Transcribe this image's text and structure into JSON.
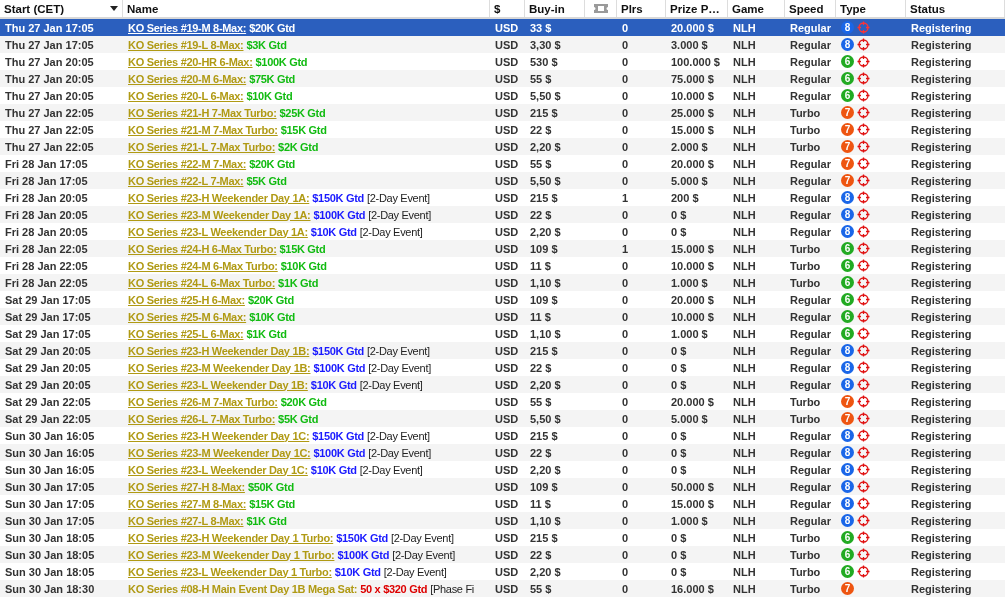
{
  "table": {
    "columns": [
      {
        "kind": "text",
        "label": "Start (CET)",
        "sort_descending": true
      },
      {
        "kind": "text",
        "label": "Name"
      },
      {
        "kind": "text",
        "label": "$"
      },
      {
        "kind": "text",
        "label": "Buy-in"
      },
      {
        "kind": "icon"
      },
      {
        "kind": "text",
        "label": "Plrs"
      },
      {
        "kind": "text",
        "label": "Prize P…"
      },
      {
        "kind": "text",
        "label": "Game"
      },
      {
        "kind": "text",
        "label": "Speed"
      },
      {
        "kind": "text",
        "label": "Type"
      },
      {
        "kind": "text",
        "label": "Status"
      }
    ],
    "rows": [
      {
        "start": "Thu 27 Jan 17:05",
        "name": "KO Series #19-M 8-Max:",
        "gtd": {
          "text": "$20K Gtd",
          "color": "#ffffff"
        },
        "currency": "USD",
        "buyin": "33 $",
        "plrs": "0",
        "prize": "20.000 $",
        "game": "NLH",
        "speed": "Regular",
        "type": {
          "badge": "8",
          "color": "#1a66e8"
        },
        "bounty": true,
        "status": "Registering",
        "underlined": true,
        "selected": true
      },
      {
        "start": "Thu 27 Jan 17:05",
        "name": "KO Series #19-L 8-Max:",
        "gtd": {
          "text": "$3K Gtd",
          "color": "#11bb11"
        },
        "currency": "USD",
        "buyin": "3,30 $",
        "plrs": "0",
        "prize": "3.000 $",
        "game": "NLH",
        "speed": "Regular",
        "type": {
          "badge": "8",
          "color": "#1a66e8"
        },
        "bounty": true,
        "status": "Registering",
        "underlined": true,
        "selected": false
      },
      {
        "start": "Thu 27 Jan 20:05",
        "name": "KO Series #20-HR 6-Max:",
        "gtd": {
          "text": "$100K Gtd",
          "color": "#11bb11"
        },
        "currency": "USD",
        "buyin": "530 $",
        "plrs": "0",
        "prize": "100.000 $",
        "game": "NLH",
        "speed": "Regular",
        "type": {
          "badge": "6",
          "color": "#22aa22"
        },
        "bounty": true,
        "status": "Registering",
        "underlined": true,
        "selected": false
      },
      {
        "start": "Thu 27 Jan 20:05",
        "name": "KO Series #20-M 6-Max:",
        "gtd": {
          "text": "$75K Gtd",
          "color": "#11bb11"
        },
        "currency": "USD",
        "buyin": "55 $",
        "plrs": "0",
        "prize": "75.000 $",
        "game": "NLH",
        "speed": "Regular",
        "type": {
          "badge": "6",
          "color": "#22aa22"
        },
        "bounty": true,
        "status": "Registering",
        "underlined": true,
        "selected": false
      },
      {
        "start": "Thu 27 Jan 20:05",
        "name": "KO Series #20-L 6-Max:",
        "gtd": {
          "text": "$10K Gtd",
          "color": "#11bb11"
        },
        "currency": "USD",
        "buyin": "5,50 $",
        "plrs": "0",
        "prize": "10.000 $",
        "game": "NLH",
        "speed": "Regular",
        "type": {
          "badge": "6",
          "color": "#22aa22"
        },
        "bounty": true,
        "status": "Registering",
        "underlined": true,
        "selected": false
      },
      {
        "start": "Thu 27 Jan 22:05",
        "name": "KO Series #21-H 7-Max Turbo:",
        "gtd": {
          "text": "$25K Gtd",
          "color": "#11bb11"
        },
        "currency": "USD",
        "buyin": "215 $",
        "plrs": "0",
        "prize": "25.000 $",
        "game": "NLH",
        "speed": "Turbo",
        "type": {
          "badge": "7",
          "color": "#ee5511"
        },
        "bounty": true,
        "status": "Registering",
        "underlined": true,
        "selected": false
      },
      {
        "start": "Thu 27 Jan 22:05",
        "name": "KO Series #21-M 7-Max Turbo:",
        "gtd": {
          "text": "$15K Gtd",
          "color": "#11bb11"
        },
        "currency": "USD",
        "buyin": "22 $",
        "plrs": "0",
        "prize": "15.000 $",
        "game": "NLH",
        "speed": "Turbo",
        "type": {
          "badge": "7",
          "color": "#ee5511"
        },
        "bounty": true,
        "status": "Registering",
        "underlined": true,
        "selected": false
      },
      {
        "start": "Thu 27 Jan 22:05",
        "name": "KO Series #21-L 7-Max Turbo:",
        "gtd": {
          "text": "$2K Gtd",
          "color": "#11bb11"
        },
        "currency": "USD",
        "buyin": "2,20 $",
        "plrs": "0",
        "prize": "2.000 $",
        "game": "NLH",
        "speed": "Turbo",
        "type": {
          "badge": "7",
          "color": "#ee5511"
        },
        "bounty": true,
        "status": "Registering",
        "underlined": true,
        "selected": false
      },
      {
        "start": "Fri 28 Jan 17:05",
        "name": "KO Series #22-M 7-Max:",
        "gtd": {
          "text": "$20K Gtd",
          "color": "#11bb11"
        },
        "currency": "USD",
        "buyin": "55 $",
        "plrs": "0",
        "prize": "20.000 $",
        "game": "NLH",
        "speed": "Regular",
        "type": {
          "badge": "7",
          "color": "#ee5511"
        },
        "bounty": true,
        "status": "Registering",
        "underlined": true,
        "selected": false
      },
      {
        "start": "Fri 28 Jan 17:05",
        "name": "KO Series #22-L 7-Max:",
        "gtd": {
          "text": "$5K Gtd",
          "color": "#11bb11"
        },
        "currency": "USD",
        "buyin": "5,50 $",
        "plrs": "0",
        "prize": "5.000 $",
        "game": "NLH",
        "speed": "Regular",
        "type": {
          "badge": "7",
          "color": "#ee5511"
        },
        "bounty": true,
        "status": "Registering",
        "underlined": true,
        "selected": false
      },
      {
        "start": "Fri 28 Jan 20:05",
        "name": "KO Series #23-H Weekender Day 1A:",
        "gtd": {
          "text": "$150K Gtd",
          "color": "#1a1aff"
        },
        "note": "[2-Day Event]",
        "currency": "USD",
        "buyin": "215 $",
        "plrs": "1",
        "prize": "200 $",
        "game": "NLH",
        "speed": "Regular",
        "type": {
          "badge": "8",
          "color": "#1a66e8"
        },
        "bounty": true,
        "status": "Registering",
        "underlined": true,
        "selected": false
      },
      {
        "start": "Fri 28 Jan 20:05",
        "name": "KO Series #23-M Weekender Day 1A:",
        "gtd": {
          "text": "$100K Gtd",
          "color": "#1a1aff"
        },
        "note": "[2-Day Event]",
        "currency": "USD",
        "buyin": "22 $",
        "plrs": "0",
        "prize": "0 $",
        "game": "NLH",
        "speed": "Regular",
        "type": {
          "badge": "8",
          "color": "#1a66e8"
        },
        "bounty": true,
        "status": "Registering",
        "underlined": true,
        "selected": false
      },
      {
        "start": "Fri 28 Jan 20:05",
        "name": "KO Series #23-L Weekender Day 1A:",
        "gtd": {
          "text": "$10K Gtd",
          "color": "#1a1aff"
        },
        "note": "[2-Day Event]",
        "currency": "USD",
        "buyin": "2,20 $",
        "plrs": "0",
        "prize": "0 $",
        "game": "NLH",
        "speed": "Regular",
        "type": {
          "badge": "8",
          "color": "#1a66e8"
        },
        "bounty": true,
        "status": "Registering",
        "underlined": true,
        "selected": false
      },
      {
        "start": "Fri 28 Jan 22:05",
        "name": "KO Series #24-H 6-Max Turbo:",
        "gtd": {
          "text": "$15K Gtd",
          "color": "#11bb11"
        },
        "currency": "USD",
        "buyin": "109 $",
        "plrs": "1",
        "prize": "15.000 $",
        "game": "NLH",
        "speed": "Turbo",
        "type": {
          "badge": "6",
          "color": "#22aa22"
        },
        "bounty": true,
        "status": "Registering",
        "underlined": true,
        "selected": false
      },
      {
        "start": "Fri 28 Jan 22:05",
        "name": "KO Series #24-M 6-Max Turbo:",
        "gtd": {
          "text": "$10K Gtd",
          "color": "#11bb11"
        },
        "currency": "USD",
        "buyin": "11 $",
        "plrs": "0",
        "prize": "10.000 $",
        "game": "NLH",
        "speed": "Turbo",
        "type": {
          "badge": "6",
          "color": "#22aa22"
        },
        "bounty": true,
        "status": "Registering",
        "underlined": true,
        "selected": false
      },
      {
        "start": "Fri 28 Jan 22:05",
        "name": "KO Series #24-L 6-Max Turbo:",
        "gtd": {
          "text": "$1K Gtd",
          "color": "#11bb11"
        },
        "currency": "USD",
        "buyin": "1,10 $",
        "plrs": "0",
        "prize": "1.000 $",
        "game": "NLH",
        "speed": "Turbo",
        "type": {
          "badge": "6",
          "color": "#22aa22"
        },
        "bounty": true,
        "status": "Registering",
        "underlined": true,
        "selected": false
      },
      {
        "start": "Sat 29 Jan 17:05",
        "name": "KO Series #25-H 6-Max:",
        "gtd": {
          "text": "$20K Gtd",
          "color": "#11bb11"
        },
        "currency": "USD",
        "buyin": "109 $",
        "plrs": "0",
        "prize": "20.000 $",
        "game": "NLH",
        "speed": "Regular",
        "type": {
          "badge": "6",
          "color": "#22aa22"
        },
        "bounty": true,
        "status": "Registering",
        "underlined": true,
        "selected": false
      },
      {
        "start": "Sat 29 Jan 17:05",
        "name": "KO Series #25-M 6-Max:",
        "gtd": {
          "text": "$10K Gtd",
          "color": "#11bb11"
        },
        "currency": "USD",
        "buyin": "11 $",
        "plrs": "0",
        "prize": "10.000 $",
        "game": "NLH",
        "speed": "Regular",
        "type": {
          "badge": "6",
          "color": "#22aa22"
        },
        "bounty": true,
        "status": "Registering",
        "underlined": true,
        "selected": false
      },
      {
        "start": "Sat 29 Jan 17:05",
        "name": "KO Series #25-L 6-Max:",
        "gtd": {
          "text": "$1K Gtd",
          "color": "#11bb11"
        },
        "currency": "USD",
        "buyin": "1,10 $",
        "plrs": "0",
        "prize": "1.000 $",
        "game": "NLH",
        "speed": "Regular",
        "type": {
          "badge": "6",
          "color": "#22aa22"
        },
        "bounty": true,
        "status": "Registering",
        "underlined": true,
        "selected": false
      },
      {
        "start": "Sat 29 Jan 20:05",
        "name": "KO Series #23-H Weekender Day 1B:",
        "gtd": {
          "text": "$150K Gtd",
          "color": "#1a1aff"
        },
        "note": "[2-Day Event]",
        "currency": "USD",
        "buyin": "215 $",
        "plrs": "0",
        "prize": "0 $",
        "game": "NLH",
        "speed": "Regular",
        "type": {
          "badge": "8",
          "color": "#1a66e8"
        },
        "bounty": true,
        "status": "Registering",
        "underlined": true,
        "selected": false
      },
      {
        "start": "Sat 29 Jan 20:05",
        "name": "KO Series #23-M Weekender Day 1B:",
        "gtd": {
          "text": "$100K Gtd",
          "color": "#1a1aff"
        },
        "note": "[2-Day Event]",
        "currency": "USD",
        "buyin": "22 $",
        "plrs": "0",
        "prize": "0 $",
        "game": "NLH",
        "speed": "Regular",
        "type": {
          "badge": "8",
          "color": "#1a66e8"
        },
        "bounty": true,
        "status": "Registering",
        "underlined": true,
        "selected": false
      },
      {
        "start": "Sat 29 Jan 20:05",
        "name": "KO Series #23-L Weekender Day 1B:",
        "gtd": {
          "text": "$10K Gtd",
          "color": "#1a1aff"
        },
        "note": "[2-Day Event]",
        "currency": "USD",
        "buyin": "2,20 $",
        "plrs": "0",
        "prize": "0 $",
        "game": "NLH",
        "speed": "Regular",
        "type": {
          "badge": "8",
          "color": "#1a66e8"
        },
        "bounty": true,
        "status": "Registering",
        "underlined": true,
        "selected": false
      },
      {
        "start": "Sat 29 Jan 22:05",
        "name": "KO Series #26-M 7-Max Turbo:",
        "gtd": {
          "text": "$20K Gtd",
          "color": "#11bb11"
        },
        "currency": "USD",
        "buyin": "55 $",
        "plrs": "0",
        "prize": "20.000 $",
        "game": "NLH",
        "speed": "Turbo",
        "type": {
          "badge": "7",
          "color": "#ee5511"
        },
        "bounty": true,
        "status": "Registering",
        "underlined": true,
        "selected": false
      },
      {
        "start": "Sat 29 Jan 22:05",
        "name": "KO Series #26-L 7-Max Turbo:",
        "gtd": {
          "text": "$5K Gtd",
          "color": "#11bb11"
        },
        "currency": "USD",
        "buyin": "5,50 $",
        "plrs": "0",
        "prize": "5.000 $",
        "game": "NLH",
        "speed": "Turbo",
        "type": {
          "badge": "7",
          "color": "#ee5511"
        },
        "bounty": true,
        "status": "Registering",
        "underlined": true,
        "selected": false
      },
      {
        "start": "Sun 30 Jan 16:05",
        "name": "KO Series #23-H Weekender Day 1C:",
        "gtd": {
          "text": "$150K Gtd",
          "color": "#1a1aff"
        },
        "note": "[2-Day Event]",
        "currency": "USD",
        "buyin": "215 $",
        "plrs": "0",
        "prize": "0 $",
        "game": "NLH",
        "speed": "Regular",
        "type": {
          "badge": "8",
          "color": "#1a66e8"
        },
        "bounty": true,
        "status": "Registering",
        "underlined": true,
        "selected": false
      },
      {
        "start": "Sun 30 Jan 16:05",
        "name": "KO Series #23-M Weekender Day 1C:",
        "gtd": {
          "text": "$100K Gtd",
          "color": "#1a1aff"
        },
        "note": "[2-Day Event]",
        "currency": "USD",
        "buyin": "22 $",
        "plrs": "0",
        "prize": "0 $",
        "game": "NLH",
        "speed": "Regular",
        "type": {
          "badge": "8",
          "color": "#1a66e8"
        },
        "bounty": true,
        "status": "Registering",
        "underlined": true,
        "selected": false
      },
      {
        "start": "Sun 30 Jan 16:05",
        "name": "KO Series #23-L Weekender Day 1C:",
        "gtd": {
          "text": "$10K Gtd",
          "color": "#1a1aff"
        },
        "note": "[2-Day Event]",
        "currency": "USD",
        "buyin": "2,20 $",
        "plrs": "0",
        "prize": "0 $",
        "game": "NLH",
        "speed": "Regular",
        "type": {
          "badge": "8",
          "color": "#1a66e8"
        },
        "bounty": true,
        "status": "Registering",
        "underlined": true,
        "selected": false
      },
      {
        "start": "Sun 30 Jan 17:05",
        "name": "KO Series #27-H 8-Max:",
        "gtd": {
          "text": "$50K Gtd",
          "color": "#11bb11"
        },
        "currency": "USD",
        "buyin": "109 $",
        "plrs": "0",
        "prize": "50.000 $",
        "game": "NLH",
        "speed": "Regular",
        "type": {
          "badge": "8",
          "color": "#1a66e8"
        },
        "bounty": true,
        "status": "Registering",
        "underlined": true,
        "selected": false
      },
      {
        "start": "Sun 30 Jan 17:05",
        "name": "KO Series #27-M 8-Max:",
        "gtd": {
          "text": "$15K Gtd",
          "color": "#11bb11"
        },
        "currency": "USD",
        "buyin": "11 $",
        "plrs": "0",
        "prize": "15.000 $",
        "game": "NLH",
        "speed": "Regular",
        "type": {
          "badge": "8",
          "color": "#1a66e8"
        },
        "bounty": true,
        "status": "Registering",
        "underlined": true,
        "selected": false
      },
      {
        "start": "Sun 30 Jan 17:05",
        "name": "KO Series #27-L 8-Max:",
        "gtd": {
          "text": "$1K Gtd",
          "color": "#11bb11"
        },
        "currency": "USD",
        "buyin": "1,10 $",
        "plrs": "0",
        "prize": "1.000 $",
        "game": "NLH",
        "speed": "Regular",
        "type": {
          "badge": "8",
          "color": "#1a66e8"
        },
        "bounty": true,
        "status": "Registering",
        "underlined": true,
        "selected": false
      },
      {
        "start": "Sun 30 Jan 18:05",
        "name": "KO Series #23-H Weekender Day 1 Turbo:",
        "gtd": {
          "text": "$150K Gtd",
          "color": "#1a1aff"
        },
        "note": "[2-Day Event]",
        "currency": "USD",
        "buyin": "215 $",
        "plrs": "0",
        "prize": "0 $",
        "game": "NLH",
        "speed": "Turbo",
        "type": {
          "badge": "6",
          "color": "#22aa22"
        },
        "bounty": true,
        "status": "Registering",
        "underlined": true,
        "selected": false
      },
      {
        "start": "Sun 30 Jan 18:05",
        "name": "KO Series #23-M Weekender Day 1 Turbo:",
        "gtd": {
          "text": "$100K Gtd",
          "color": "#1a1aff"
        },
        "note": "[2-Day Event]",
        "currency": "USD",
        "buyin": "22 $",
        "plrs": "0",
        "prize": "0 $",
        "game": "NLH",
        "speed": "Turbo",
        "type": {
          "badge": "6",
          "color": "#22aa22"
        },
        "bounty": true,
        "status": "Registering",
        "underlined": true,
        "selected": false
      },
      {
        "start": "Sun 30 Jan 18:05",
        "name": "KO Series #23-L Weekender Day 1 Turbo:",
        "gtd": {
          "text": "$10K Gtd",
          "color": "#1a1aff"
        },
        "note": "[2-Day Event]",
        "currency": "USD",
        "buyin": "2,20 $",
        "plrs": "0",
        "prize": "0 $",
        "game": "NLH",
        "speed": "Turbo",
        "type": {
          "badge": "6",
          "color": "#22aa22"
        },
        "bounty": true,
        "status": "Registering",
        "underlined": true,
        "selected": false
      },
      {
        "start": "Sun 30 Jan 18:30",
        "name": "KO Series #08-H Main Event Day 1B Mega Sat:",
        "gtd": {
          "text": "50 x $320 Gtd",
          "color": "#dd0000"
        },
        "note": "[Phase Fi",
        "currency": "USD",
        "buyin": "55 $",
        "plrs": "0",
        "prize": "16.000 $",
        "game": "NLH",
        "speed": "Turbo",
        "type": {
          "badge": "7",
          "color": "#ee5511"
        },
        "bounty": false,
        "status": "Registering",
        "underlined": false,
        "selected": false
      }
    ]
  }
}
